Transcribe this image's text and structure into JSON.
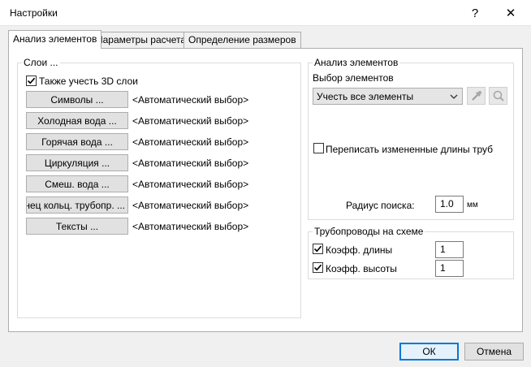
{
  "window": {
    "title": "Настройки",
    "help_glyph": "?",
    "close_glyph": "✕"
  },
  "tabs": [
    {
      "label": "Анализ элементов",
      "active": true
    },
    {
      "label": "Параметры расчета",
      "active": false
    },
    {
      "label": "Определение размеров",
      "active": false
    }
  ],
  "layers": {
    "group_title": "Слои ...",
    "include_3d": {
      "label": "Также учесть 3D слои",
      "checked": true
    },
    "rows": [
      {
        "button": "Символы ...",
        "value": "<Автоматический выбор>"
      },
      {
        "button": "Холодная вода ...",
        "value": "<Автоматический выбор>"
      },
      {
        "button": "Горячая вода ...",
        "value": "<Автоматический выбор>"
      },
      {
        "button": "Циркуляция ...",
        "value": "<Автоматический выбор>"
      },
      {
        "button": "Смеш. вода ...",
        "value": "<Автоматический выбор>"
      },
      {
        "button": "Конец кольц. трубопр. ...",
        "value": "<Автоматический выбор>"
      },
      {
        "button": "Тексты ...",
        "value": "<Автоматический выбор>"
      }
    ]
  },
  "analysis": {
    "group_title": "Анализ элементов",
    "select_label": "Выбор элементов",
    "select_value": "Учесть все элементы",
    "rewrite": {
      "label": "Переписать измененные длины труб",
      "checked": false
    },
    "radius_label": "Радиус поиска:",
    "radius_value": "1.0",
    "radius_unit": "мм"
  },
  "pipes": {
    "group_title": "Трубопроводы на схеме",
    "length": {
      "label": "Коэфф. длины",
      "checked": true,
      "value": "1"
    },
    "height": {
      "label": "Коэфф. высоты",
      "checked": true,
      "value": "1"
    }
  },
  "footer": {
    "ok": "ОК",
    "cancel": "Отмена"
  },
  "colors": {
    "accent": "#0078d7",
    "background": "#f0f0f0"
  }
}
